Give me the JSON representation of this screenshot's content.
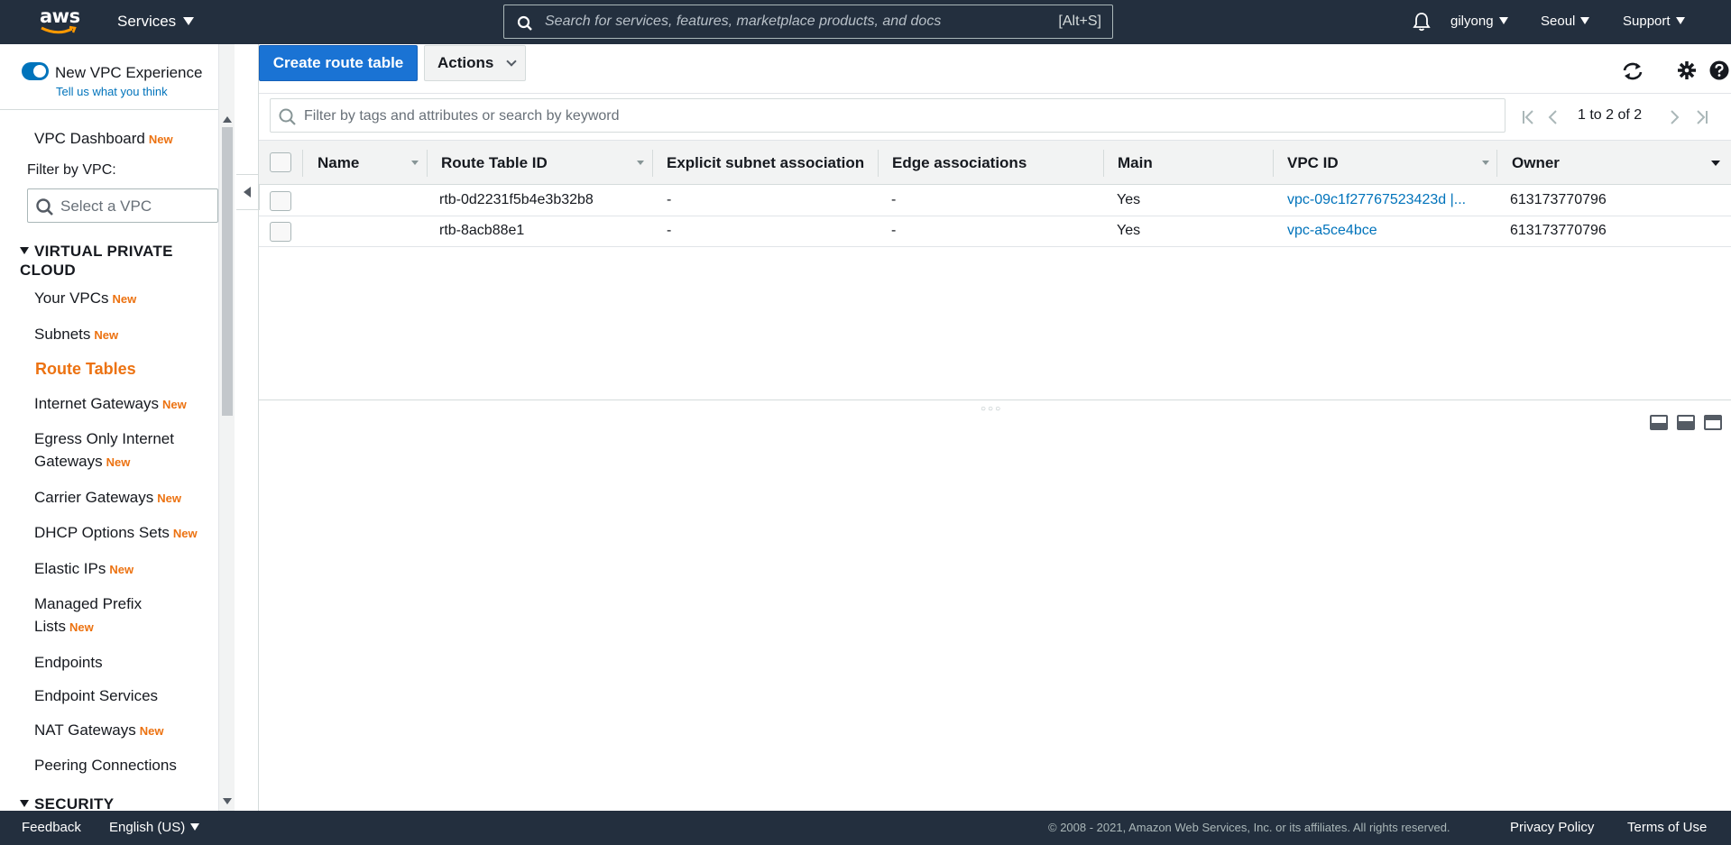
{
  "topnav": {
    "logo_text": "aws",
    "services_label": "Services",
    "search_placeholder": "Search for services, features, marketplace products, and docs",
    "search_shortcut": "[Alt+S]",
    "user": "gilyong",
    "region": "Seoul",
    "support": "Support"
  },
  "sidebar": {
    "new_experience_label": "New VPC Experience",
    "tell_us": "Tell us what you think",
    "dashboard": {
      "label": "VPC Dashboard",
      "badge": "New"
    },
    "filter_label": "Filter by VPC:",
    "filter_placeholder": "Select a VPC",
    "section_vpc": "VIRTUAL PRIVATE CLOUD",
    "items": [
      {
        "label": "Your VPCs",
        "badge": "New"
      },
      {
        "label": "Subnets",
        "badge": "New"
      },
      {
        "label": "Route Tables",
        "badge": ""
      },
      {
        "label": "Internet Gateways",
        "badge": "New"
      },
      {
        "label": "Egress Only Internet Gateways",
        "badge": "New"
      },
      {
        "label": "Carrier Gateways",
        "badge": "New"
      },
      {
        "label": "DHCP Options Sets",
        "badge": "New"
      },
      {
        "label": "Elastic IPs",
        "badge": "New"
      },
      {
        "label": "Managed Prefix Lists",
        "badge": "New"
      },
      {
        "label": "Endpoints",
        "badge": ""
      },
      {
        "label": "Endpoint Services",
        "badge": ""
      },
      {
        "label": "NAT Gateways",
        "badge": "New"
      },
      {
        "label": "Peering Connections",
        "badge": ""
      }
    ],
    "section_security": "SECURITY"
  },
  "toolbar": {
    "create_label": "Create route table",
    "actions_label": "Actions",
    "filter_placeholder": "Filter by tags and attributes or search by keyword",
    "pagination": "1 to 2 of 2"
  },
  "table": {
    "columns": [
      "Name",
      "Route Table ID",
      "Explicit subnet association",
      "Edge associations",
      "Main",
      "VPC ID",
      "Owner"
    ],
    "rows": [
      {
        "name": "",
        "route_table_id": "rtb-0d2231f5b4e3b32b8",
        "explicit": "-",
        "edge": "-",
        "main": "Yes",
        "vpc_id": "vpc-09c1f27767523423d |...",
        "owner": "613173770796"
      },
      {
        "name": "",
        "route_table_id": "rtb-8acb88e1",
        "explicit": "-",
        "edge": "-",
        "main": "Yes",
        "vpc_id": "vpc-a5ce4bce",
        "owner": "613173770796"
      }
    ]
  },
  "footer": {
    "feedback": "Feedback",
    "language": "English (US)",
    "copyright": "© 2008 - 2021, Amazon Web Services, Inc. or its affiliates. All rights reserved.",
    "privacy": "Privacy Policy",
    "terms": "Terms of Use"
  },
  "colors": {
    "nav_bg": "#232f3e",
    "primary": "#1a73d4",
    "active_nav": "#ec7211",
    "link": "#0073bb"
  }
}
